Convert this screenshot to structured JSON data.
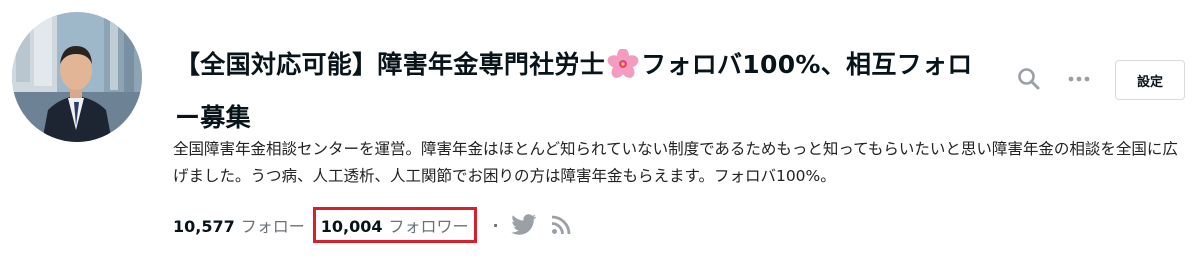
{
  "profile": {
    "name_before": "【全国対応可能】障害年金専門社労士",
    "name_after": "フォロバ100%、相互フォロー募集",
    "bio": "全国障害年金相談センターを運営。障害年金はほとんど知られていない制度であるためもっと知ってもらいたいと思い障害年金の相談を全国に広げました。うつ病、人工透析、人工関節でお困りの方は障害年金もらえます。フォロバ100%。"
  },
  "header": {
    "settings_label": "設定"
  },
  "stats": {
    "following_count": "10,577",
    "following_label": "フォロー",
    "followers_count": "10,004",
    "followers_label": "フォロワー",
    "separator": "·"
  },
  "colors": {
    "highlight": "#d6202c",
    "icon_gray": "#9aa0a6"
  },
  "icons": {
    "search": "search-icon",
    "more": "more-icon",
    "twitter": "twitter-icon",
    "rss": "rss-icon",
    "flower": "cherry-blossom-emoji"
  }
}
